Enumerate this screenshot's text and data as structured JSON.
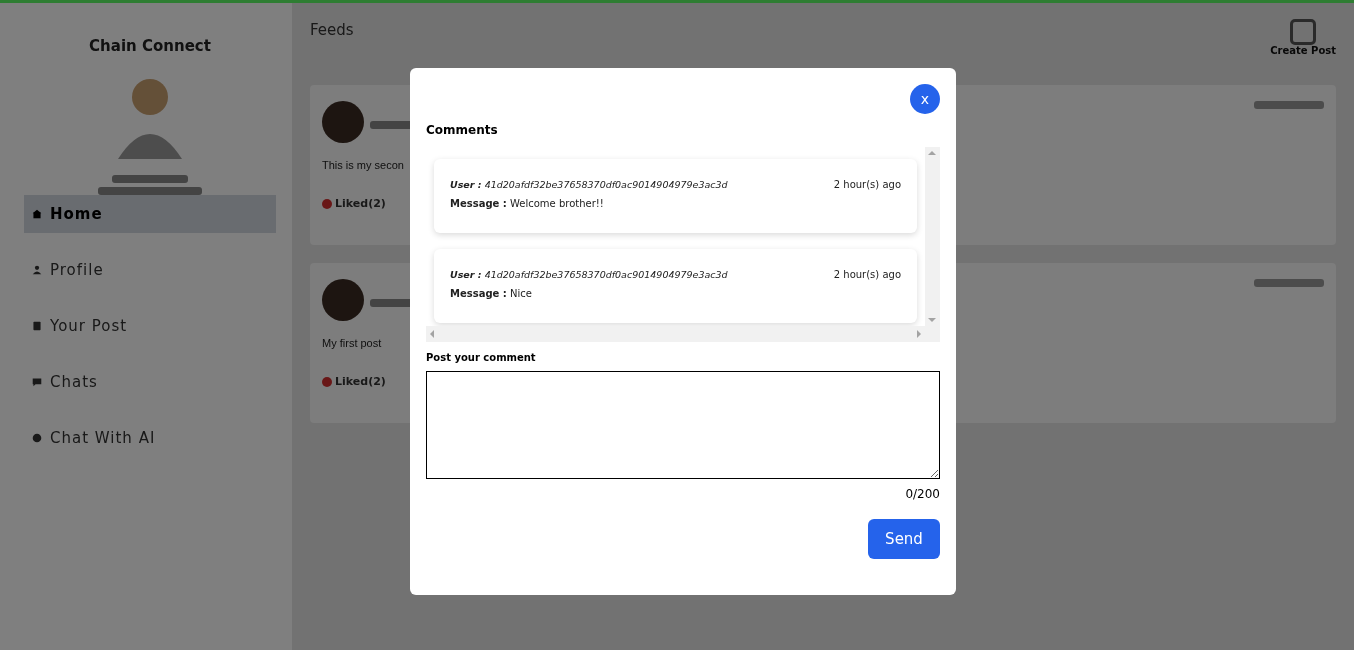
{
  "app": {
    "brand": "Chain Connect",
    "nav": [
      {
        "label": "Home",
        "selected": true
      },
      {
        "label": "Profile",
        "selected": false
      },
      {
        "label": "Your Post",
        "selected": false
      },
      {
        "label": "Chats",
        "selected": false
      },
      {
        "label": "Chat With AI",
        "selected": false
      }
    ],
    "page_title": "Feeds",
    "create_post": "Create Post",
    "posts": [
      {
        "text": "This is my secon",
        "likes": "Liked(2)"
      },
      {
        "text": "My first post",
        "likes": "Liked(2)"
      }
    ]
  },
  "modal": {
    "title": "Comments",
    "close": "x",
    "comments": [
      {
        "user_label": "User :",
        "user": "41d20afdf32be37658370df0ac9014904979e3ac3d",
        "time": "2 hour(s) ago",
        "message_label": "Message :",
        "message": "Welcome brother!!"
      },
      {
        "user_label": "User :",
        "user": "41d20afdf32be37658370df0ac9014904979e3ac3d",
        "time": "2 hour(s) ago",
        "message_label": "Message :",
        "message": "Nice"
      }
    ],
    "comment_label": "Post your comment",
    "counter": "0/200",
    "send": "Send"
  }
}
